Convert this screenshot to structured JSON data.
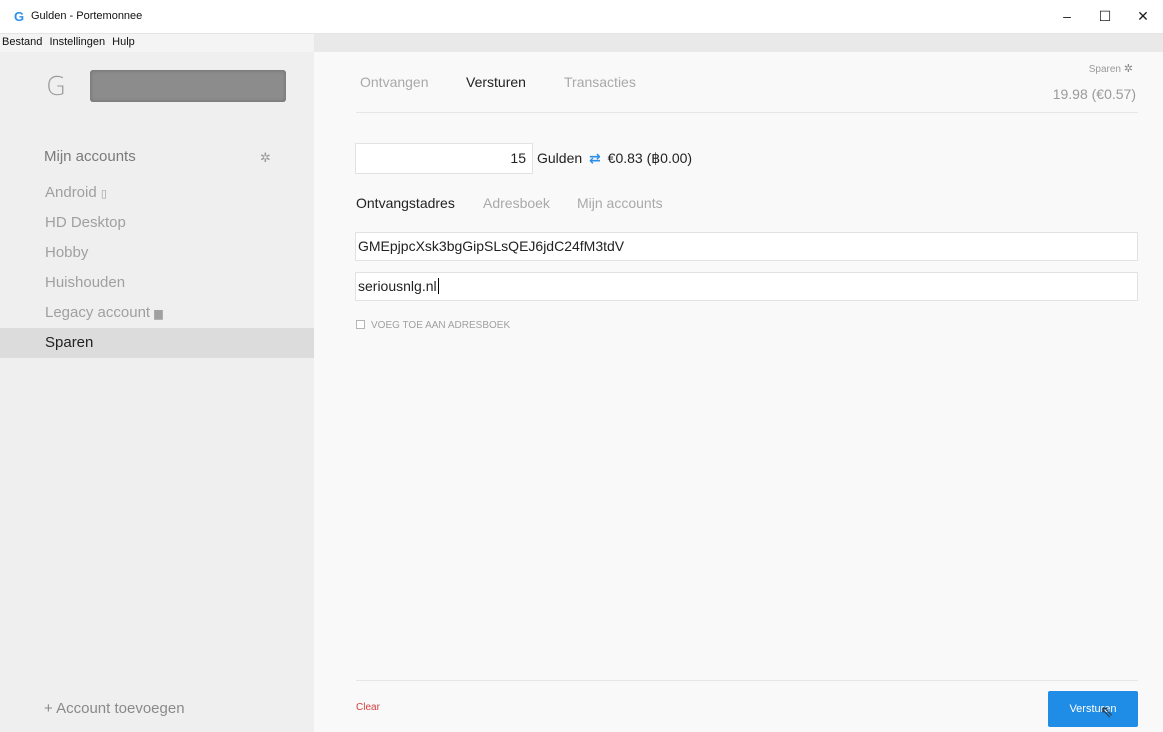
{
  "window": {
    "icon": "G",
    "title": "Gulden - Portemonnee",
    "controls": {
      "minimize": "–",
      "maximize": "☐",
      "close": "✕"
    }
  },
  "menu": [
    "Bestand",
    "Instellingen",
    "Hulp"
  ],
  "sidebar": {
    "logo": "G",
    "heading": "Mijn accounts",
    "items": [
      {
        "label": "Android",
        "suffix": "▯"
      },
      {
        "label": "HD Desktop",
        "suffix": ""
      },
      {
        "label": "Hobby",
        "suffix": ""
      },
      {
        "label": "Huishouden",
        "suffix": ""
      },
      {
        "label": "Legacy account",
        "suffix": "▆"
      },
      {
        "label": "Sparen",
        "suffix": ""
      }
    ],
    "add_account": "+ Account toevoegen"
  },
  "main": {
    "tabs": [
      "Ontvangen",
      "Versturen",
      "Transacties"
    ],
    "account_label": "Sparen",
    "balance": "19.98 (€0.57)",
    "amount": "15",
    "unit": "Gulden",
    "swap_icon": "⇄",
    "conversion": "€0.83 (฿0.00)",
    "recipient_tabs": [
      "Ontvangstadres",
      "Adresboek",
      "Mijn accounts"
    ],
    "address": "GMEpjpcXsk3bgGipSLsQEJ6jdC24fM3tdV",
    "label_value": "seriousnlg.nl",
    "add_to_addressbook": "VOEG TOE AAN ADRESBOEK",
    "clear": "Clear",
    "send": "Versturen"
  },
  "colors": {
    "accent": "#1f8ce6",
    "clear": "#d23d3d"
  }
}
